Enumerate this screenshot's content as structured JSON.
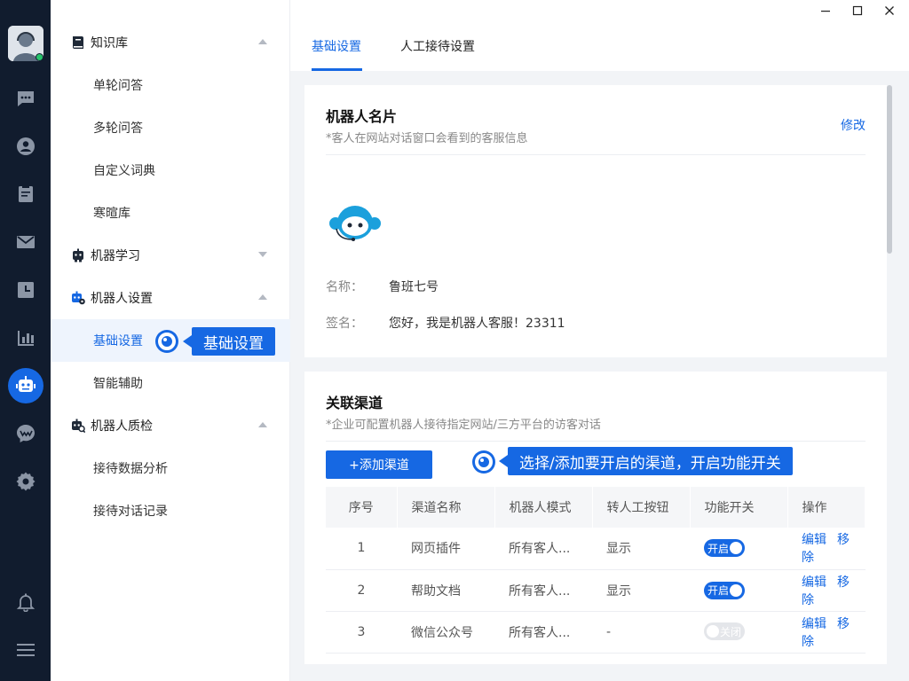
{
  "window": {
    "minimize": "—",
    "maximize": "☐",
    "close": "✕"
  },
  "rail": {
    "icons": [
      "chat-icon",
      "contacts-icon",
      "tickets-icon",
      "mail-icon",
      "history-icon",
      "stats-icon",
      "robot-icon",
      "messenger-icon",
      "settings-icon",
      "bell-icon",
      "menu-icon"
    ],
    "active": "robot-icon"
  },
  "nav": {
    "groups": [
      {
        "label": "知识库",
        "icon": "book-icon",
        "expanded": true,
        "items": [
          "单轮问答",
          "多轮问答",
          "自定义词典",
          "寒暄库"
        ]
      },
      {
        "label": "机器学习",
        "icon": "robot-learn-icon",
        "expanded": false,
        "items": []
      },
      {
        "label": "机器人设置",
        "icon": "robot-settings-icon",
        "expanded": true,
        "items": [
          "基础设置",
          "智能辅助"
        ]
      },
      {
        "label": "机器人质检",
        "icon": "robot-qc-icon",
        "expanded": true,
        "items": [
          "接待数据分析",
          "接待对话记录"
        ]
      }
    ],
    "active_item": "基础设置"
  },
  "callouts": {
    "nav": "基础设置",
    "channel": "选择/添加要开启的渠道，开启功能开关"
  },
  "tabs": [
    "基础设置",
    "人工接待设置"
  ],
  "active_tab": "基础设置",
  "robot_card": {
    "title": "机器人名片",
    "desc": "*客人在网站对话窗口会看到的客服信息",
    "edit": "修改",
    "name_label": "名称：",
    "name_value": "鲁班七号",
    "sign_label": "签名：",
    "sign_value": "您好，我是机器人客服！23311"
  },
  "channel_card": {
    "title": "关联渠道",
    "desc": "*企业可配置机器人接待指定网站/三方平台的访客对话",
    "add_button": "+添加渠道",
    "columns": [
      "序号",
      "渠道名称",
      "机器人模式",
      "转人工按钮",
      "功能开关",
      "操作"
    ],
    "rows": [
      {
        "no": "1",
        "name": "网页插件",
        "mode": "所有客人...",
        "transfer": "显示",
        "switch": "开启",
        "on": true,
        "edit": "编辑",
        "remove": "移除"
      },
      {
        "no": "2",
        "name": "帮助文档",
        "mode": "所有客人...",
        "transfer": "显示",
        "switch": "开启",
        "on": true,
        "edit": "编辑",
        "remove": "移除"
      },
      {
        "no": "3",
        "name": "微信公众号",
        "mode": "所有客人...",
        "transfer": "-",
        "switch": "关闭",
        "on": false,
        "edit": "编辑",
        "remove": "移除"
      }
    ]
  },
  "colors": {
    "accent": "#1668e3",
    "rail": "#111c2e",
    "online": "#27c46b"
  }
}
